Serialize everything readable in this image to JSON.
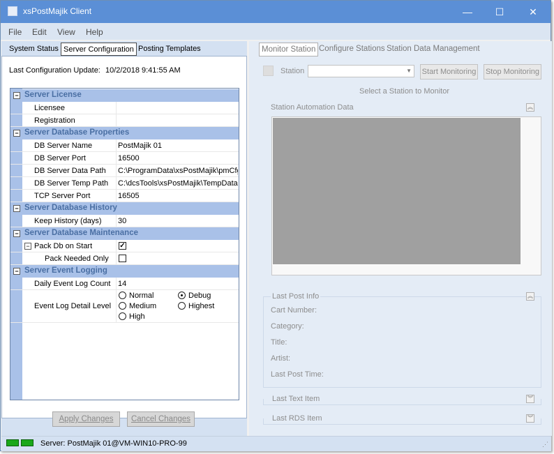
{
  "window": {
    "title": "xsPostMajik Client",
    "minimize": "—",
    "maximize": "☐",
    "close": "✕"
  },
  "menu": [
    "File",
    "Edit",
    "View",
    "Help"
  ],
  "left_tabs": [
    "System Status",
    "Server Configuration",
    "Posting Templates"
  ],
  "last_update": {
    "label": "Last Configuration Update:",
    "value": "10/2/2018 9:41:55 AM"
  },
  "grid": {
    "license": {
      "title": "Server License",
      "licensee": "Licensee",
      "registration": "Registration"
    },
    "db_props": {
      "title": "Server Database Properties",
      "rows": [
        {
          "k": "DB Server Name",
          "v": "PostMajik 01"
        },
        {
          "k": "DB Server Port",
          "v": "16500"
        },
        {
          "k": "DB Server Data Path",
          "v": "C:\\ProgramData\\xsPostMajik\\pmCfg"
        },
        {
          "k": "DB Server Temp Path",
          "v": "C:\\dcsTools\\xsPostMajik\\TempData"
        },
        {
          "k": "TCP Server Port",
          "v": "16505"
        }
      ]
    },
    "history": {
      "title": "Server Database History",
      "k": "Keep History (days)",
      "v": "30"
    },
    "maint": {
      "title": "Server Database Maintenance",
      "pack": "Pack Db on Start",
      "pack_needed": "Pack Needed Only",
      "pack_checked": true,
      "pack_needed_checked": false
    },
    "events": {
      "title": "Server Event Logging",
      "count_k": "Daily Event Log Count",
      "count_v": "14",
      "detail_k": "Event Log Detail Level",
      "levels": [
        "Normal",
        "Debug",
        "Medium",
        "Highest",
        "High"
      ],
      "selected": "Debug"
    }
  },
  "buttons": {
    "apply": "Apply Changes",
    "cancel": "Cancel Changes"
  },
  "status": {
    "text": "Server: PostMajik 01@VM-WIN10-PRO-99"
  },
  "right_tabs": [
    "Monitor Station",
    "Configure Stations",
    "Station Data Management"
  ],
  "monitor": {
    "station_label": "Station",
    "start": "Start Monitoring",
    "stop": "Stop Monitoring",
    "hint": "Select a Station to Monitor",
    "automation_title": "Station Automation Data"
  },
  "last_post": {
    "title": "Last Post Info",
    "fields": [
      "Cart Number:",
      "Category:",
      "Title:",
      "Artist:",
      "Last Post Time:"
    ]
  },
  "last_text": "Last Text Item",
  "last_rds": "Last RDS Item",
  "colors": {
    "titlebar": "#5b8fd6",
    "category": "#a9c1e8",
    "led": "#1aa81a"
  }
}
